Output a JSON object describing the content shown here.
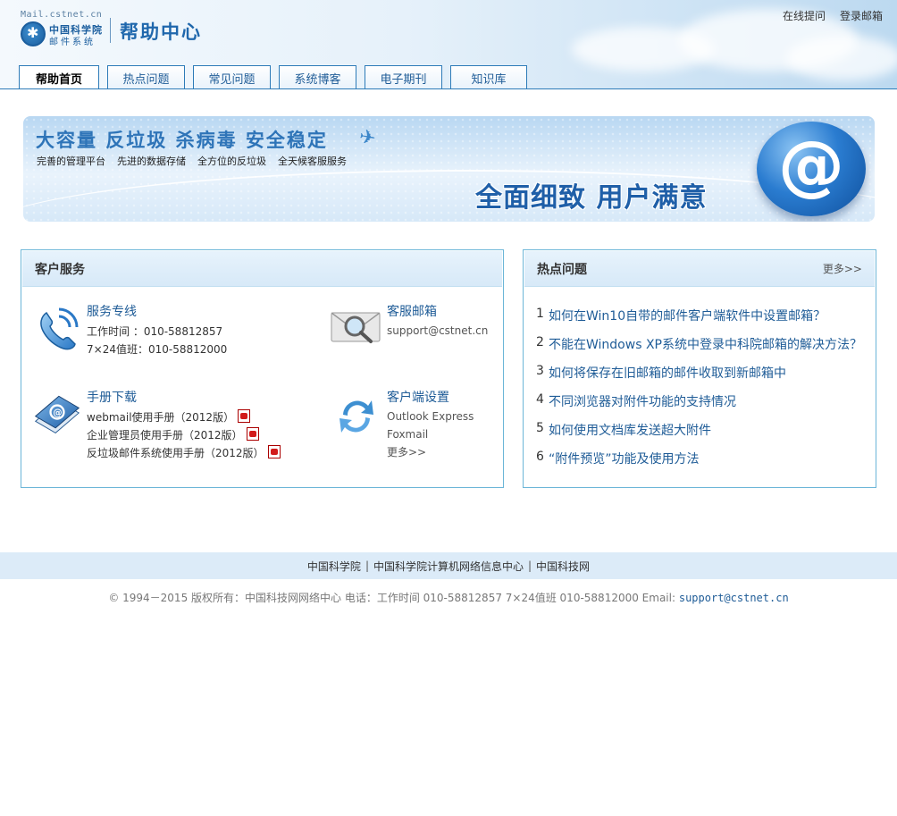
{
  "header": {
    "brand_domain": "Mail.cstnet.cn",
    "brand_name_line1": "中国科学院",
    "brand_name_line2": "邮件系统",
    "title": "帮助中心",
    "links": [
      "在线提问",
      "登录邮箱"
    ]
  },
  "tabs": [
    {
      "label": "帮助首页",
      "active": true
    },
    {
      "label": "热点问题",
      "active": false
    },
    {
      "label": "常见问题",
      "active": false
    },
    {
      "label": "系统博客",
      "active": false
    },
    {
      "label": "电子期刊",
      "active": false
    },
    {
      "label": "知识库",
      "active": false
    }
  ],
  "banner": {
    "headline": "大容量 反垃圾 杀病毒 安全稳定",
    "features": [
      "完善的管理平台",
      "先进的数据存储",
      "全方位的反垃圾",
      "全天候客服服务"
    ],
    "slogan": "全面细致 用户满意",
    "icon": "at-sign-icon"
  },
  "service": {
    "title": "客户服务",
    "hotline": {
      "title": "服务专线",
      "line1": "工作时间 ：010-58812857",
      "line2": "7×24值班：010-58812000",
      "icon": "phone-icon"
    },
    "mailbox": {
      "title": "客服邮箱",
      "line1": "support@cstnet.cn",
      "icon": "envelope-search-icon"
    },
    "manuals": {
      "title": "手册下载",
      "items": [
        "webmail使用手册（2012版）",
        "企业管理员使用手册（2012版）",
        "反垃圾邮件系统使用手册（2012版）"
      ],
      "icon": "manual-book-icon"
    },
    "client": {
      "title": "客户端设置",
      "items": [
        "Outlook Express",
        "Foxmail"
      ],
      "more": "更多>>",
      "icon": "sync-arrows-icon"
    }
  },
  "hot": {
    "title": "热点问题",
    "more": "更多>>",
    "items": [
      {
        "num": "1",
        "text": "如何在Win10自带的邮件客户端软件中设置邮箱？"
      },
      {
        "num": "2",
        "text": "不能在Windows XP系统中登录中科院邮箱的解决方法？"
      },
      {
        "num": "3",
        "text": "如何将保存在旧邮箱的邮件收取到新邮箱中"
      },
      {
        "num": "4",
        "text": "不同浏览器对附件功能的支持情况"
      },
      {
        "num": "5",
        "text": "如何使用文档库发送超大附件"
      },
      {
        "num": "6",
        "text": "“附件预览”功能及使用方法"
      }
    ]
  },
  "footer": {
    "links": [
      "中国科学院",
      "中国科学院计算机网络信息中心",
      "中国科技网"
    ],
    "separator": "|",
    "copyright": "© 1994－2015 版权所有：中国科技网网络中心 电话：工作时间 010-58812857 7×24值班 010-58812000 Email:",
    "email": "support@cstnet.cn"
  },
  "colors": {
    "accent": "#1f5c97",
    "border": "#6cb6d8",
    "header_bg": "#cfe4f5"
  }
}
